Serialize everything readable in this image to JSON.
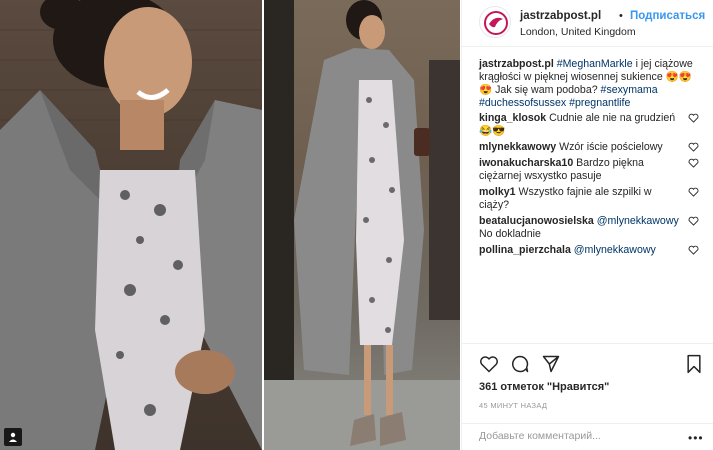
{
  "post": {
    "username": "jastrzabpost.pl",
    "follow_label": "Подписаться",
    "separator": "•",
    "location": "London, United Kingdom"
  },
  "caption": {
    "username": "jastrzabpost.pl",
    "tag1": "#MeghanMarkle",
    "text": " i jej ciążowe krągłości w pięknej wiosennej sukience 😍😍😍 Jak się wam podoba? ",
    "tag2": "#sexymama",
    "tag3": "#duchessofsussex",
    "tag4": "#pregnantlife"
  },
  "comments": [
    {
      "user": "kinga_klosok",
      "text": "Cudnie ale nie na grudzień 😂😎"
    },
    {
      "user": "mlynekkawowy",
      "text": "Wzór iście pościelowy"
    },
    {
      "user": "iwonakucharska10",
      "text": "Bardzo piękna ciężarnej wsxystko pasuje"
    },
    {
      "user": "molky1",
      "text": "Wszystko fajnie ale szpilki w ciąży?"
    },
    {
      "user": "beatalucjanowosielska",
      "mention": "@mlynekkawowy",
      "text": " No dokladnie"
    },
    {
      "user": "pollina_pierzchala",
      "mention": "@mlynekkawowy",
      "text": ""
    }
  ],
  "likes": "361 отметок \"Нравится\"",
  "timestamp": "45 МИНУТ НАЗАД",
  "comment_placeholder": "Добавьте комментарий...",
  "more_label": "•••",
  "colors": {
    "link": "#3897f0",
    "hashtag": "#003569",
    "border": "#efefef",
    "avatar_brand": "#c2185b"
  },
  "icons": {
    "heart": "heart-icon",
    "comment": "comment-icon",
    "share": "share-icon",
    "save": "bookmark-icon",
    "user_tag": "user-icon"
  }
}
